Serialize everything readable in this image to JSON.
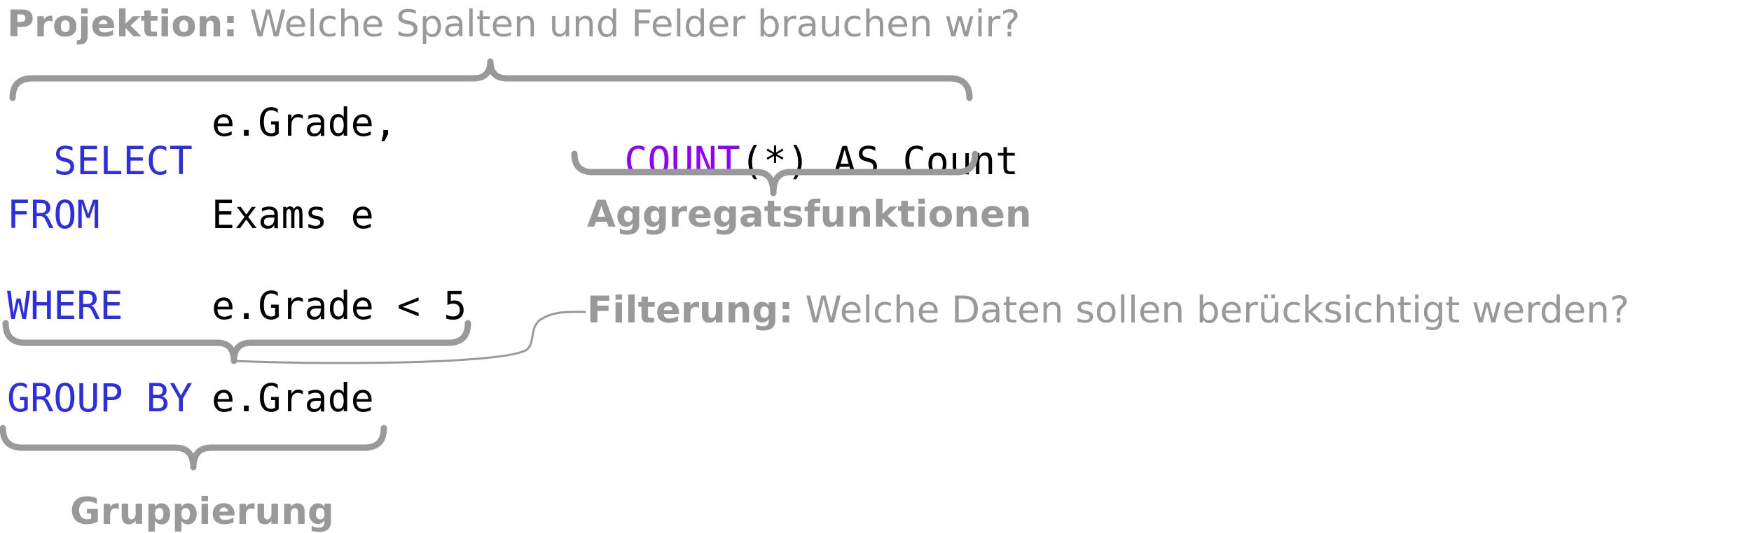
{
  "annotations": {
    "projection": {
      "label": "Projektion:",
      "text": " Welche Spalten und Felder brauchen wir?"
    },
    "aggregate": {
      "label": "Aggregatsfunktionen"
    },
    "filter": {
      "label": "Filterung:",
      "text": " Welche Daten sollen berücksichtigt werden?"
    },
    "group": {
      "label": "Gruppierung"
    }
  },
  "query": {
    "select_kw": "SELECT",
    "select_col": "e.Grade,",
    "count_fn": "COUNT",
    "count_args": "(*) AS Count",
    "from_kw": "FROM",
    "from_table": "Exams e",
    "where_kw": "WHERE",
    "where_cond": "e.Grade < 5",
    "group_kw": "GROUP BY",
    "group_col": "e.Grade"
  },
  "colors": {
    "keyword": "#2d2ee3",
    "function": "#8f00ff",
    "annotation": "#999999",
    "code": "#000000"
  }
}
